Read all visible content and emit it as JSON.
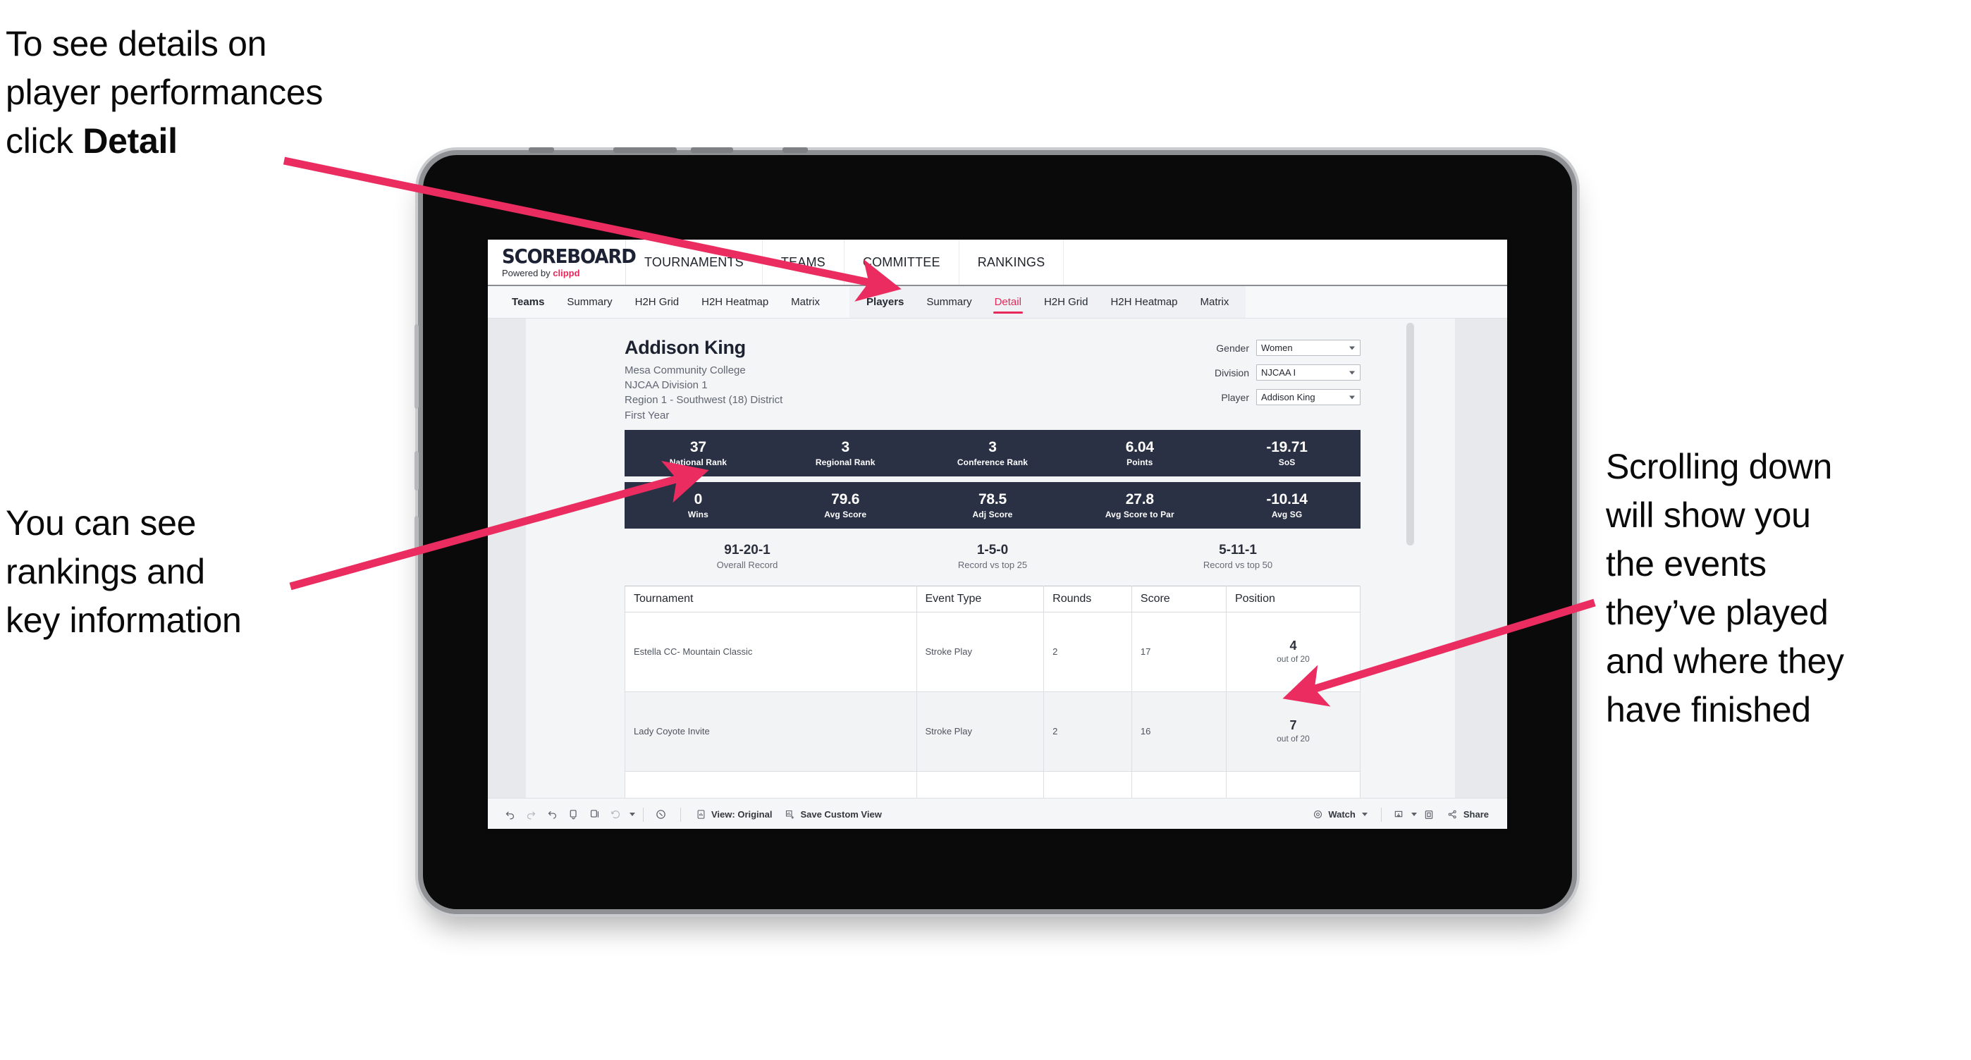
{
  "annotations": {
    "detail": {
      "text_plain": "To see details on\nplayer performances\nclick ",
      "bold": "Detail"
    },
    "rankings": {
      "text": "You can see\nrankings and\nkey information"
    },
    "scrolling": {
      "text": "Scrolling down\nwill show you\nthe events\nthey’ve played\nand where they\nhave finished"
    }
  },
  "accent_color": "#e8275a",
  "navy_color": "#2b3145",
  "app": {
    "brand": {
      "title": "SCOREBOARD",
      "powered_prefix": "Powered by ",
      "powered_name": "clippd"
    },
    "topnav": [
      "TOURNAMENTS",
      "TEAMS",
      "COMMITTEE",
      "RANKINGS"
    ],
    "subnav": {
      "group_teams": [
        "Teams",
        "Summary",
        "H2H Grid",
        "H2H Heatmap",
        "Matrix"
      ],
      "group_players": [
        "Players",
        "Summary",
        "Detail",
        "H2H Grid",
        "H2H Heatmap",
        "Matrix"
      ],
      "active": "Detail"
    }
  },
  "player": {
    "name": "Addison King",
    "school": "Mesa Community College",
    "division": "NJCAA Division 1",
    "region": "Region 1 - Southwest (18) District",
    "year": "First Year"
  },
  "filters": [
    {
      "label": "Gender",
      "value": "Women"
    },
    {
      "label": "Division",
      "value": "NJCAA I"
    },
    {
      "label": "Player",
      "value": "Addison King"
    }
  ],
  "kpis_row1": [
    {
      "value": "37",
      "label": "National Rank"
    },
    {
      "value": "3",
      "label": "Regional Rank"
    },
    {
      "value": "3",
      "label": "Conference Rank"
    },
    {
      "value": "6.04",
      "label": "Points"
    },
    {
      "value": "-19.71",
      "label": "SoS"
    }
  ],
  "kpis_row2": [
    {
      "value": "0",
      "label": "Wins"
    },
    {
      "value": "79.6",
      "label": "Avg Score"
    },
    {
      "value": "78.5",
      "label": "Adj Score"
    },
    {
      "value": "27.8",
      "label": "Avg Score to Par"
    },
    {
      "value": "-10.14",
      "label": "Avg SG"
    }
  ],
  "records": [
    {
      "value": "91-20-1",
      "label": "Overall Record"
    },
    {
      "value": "1-5-0",
      "label": "Record vs top 25"
    },
    {
      "value": "5-11-1",
      "label": "Record vs top 50"
    }
  ],
  "table": {
    "columns": [
      "Tournament",
      "Event Type",
      "Rounds",
      "Score",
      "Position"
    ],
    "rows": [
      {
        "tournament": "Estella CC- Mountain Classic",
        "event_type": "Stroke Play",
        "rounds": "2",
        "score": "17",
        "position": "4",
        "position_sub": "out of 20"
      },
      {
        "tournament": "Lady Coyote Invite",
        "event_type": "Stroke Play",
        "rounds": "2",
        "score": "16",
        "position": "7",
        "position_sub": "out of 20"
      }
    ]
  },
  "toolbar": {
    "view_label": "View: Original",
    "save_label": "Save Custom View",
    "watch_label": "Watch",
    "share_label": "Share"
  }
}
